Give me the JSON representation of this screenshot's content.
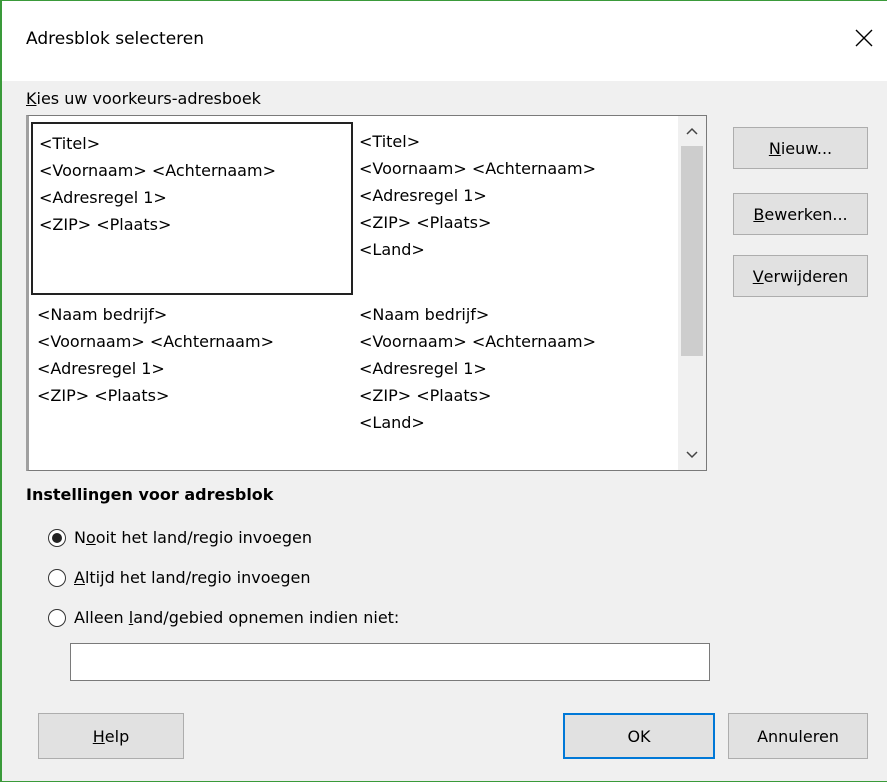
{
  "window": {
    "title": "Adresblok selecteren"
  },
  "addressbook": {
    "label_accel": "K",
    "label_rest": "ies uw voorkeurs-adresboek",
    "blocks": [
      {
        "lines": [
          "<Titel>",
          "<Voornaam> <Achternaam>",
          "<Adresregel 1>",
          "<ZIP> <Plaats>"
        ],
        "selected": true
      },
      {
        "lines": [
          "<Titel>",
          "<Voornaam> <Achternaam>",
          "<Adresregel 1>",
          "<ZIP> <Plaats>",
          "<Land>"
        ],
        "selected": false
      },
      {
        "lines": [
          "<Naam bedrijf>",
          "<Voornaam> <Achternaam>",
          "<Adresregel 1>",
          "<ZIP> <Plaats>"
        ],
        "selected": false
      },
      {
        "lines": [
          "<Naam bedrijf>",
          "<Voornaam> <Achternaam>",
          "<Adresregel 1>",
          "<ZIP> <Plaats>",
          "<Land>"
        ],
        "selected": false
      }
    ]
  },
  "side_buttons": {
    "new": {
      "accel": "N",
      "rest": "ieuw..."
    },
    "edit": {
      "accel": "B",
      "rest": "ewerken..."
    },
    "delete": {
      "accel": "V",
      "rest": "erwijderen"
    }
  },
  "settings": {
    "heading": "Instellingen voor adresblok",
    "options": [
      {
        "pre": "N",
        "accel": "o",
        "rest": "oit het land/regio invoegen",
        "checked": true
      },
      {
        "pre": "",
        "accel": "A",
        "rest": "ltijd het land/regio invoegen",
        "checked": false
      },
      {
        "pre": "Alleen ",
        "accel": "l",
        "rest": "and/gebied opnemen indien niet:",
        "checked": false
      }
    ],
    "country_value": ""
  },
  "footer": {
    "help": {
      "accel": "H",
      "rest": "elp"
    },
    "ok": "OK",
    "cancel": "Annuleren"
  },
  "icons": {
    "close": "close-icon",
    "scroll_up": "chevron-up-icon",
    "scroll_down": "chevron-down-icon"
  }
}
